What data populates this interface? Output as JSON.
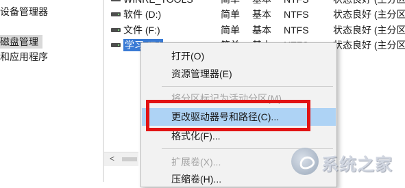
{
  "tree": {
    "items": [
      {
        "label": "设备管理器",
        "selected": false
      },
      {
        "label": "磁盘管理",
        "selected": true
      },
      {
        "label": "和应用程序",
        "selected": false
      }
    ]
  },
  "volumes": {
    "rows": [
      {
        "name": "WINRE_TOOLS",
        "layout": "简单",
        "type": "基本",
        "fs": "NTFS",
        "status": "状态良好 (主分区"
      },
      {
        "name": "软件 (D:)",
        "layout": "简单",
        "type": "基本",
        "fs": "NTFS",
        "status": "状态良好 (主分区"
      },
      {
        "name": "文件 (F:)",
        "layout": "简单",
        "type": "基本",
        "fs": "NTFS",
        "status": "状态良好 (主分区"
      },
      {
        "name": "学习 (E:)",
        "layout": "简单",
        "type": "基本",
        "fs": "NTFS",
        "status": "状态良好 (主分区"
      }
    ]
  },
  "context_menu": {
    "open": "打开(O)",
    "explorer": "资源管理器(E)",
    "mark_active": "将分区标记为活动分区(M)",
    "change_letter": "更改驱动器号和路径(C)...",
    "format": "格式化(F)...",
    "extend": "扩展卷(X)...",
    "shrink": "压缩卷(H)..."
  },
  "watermark": {
    "text": "系统之家"
  },
  "colors": {
    "highlight_red": "#e21313",
    "menu_hover": "#aed3f5",
    "selected_volume": "#3a7bd5"
  }
}
